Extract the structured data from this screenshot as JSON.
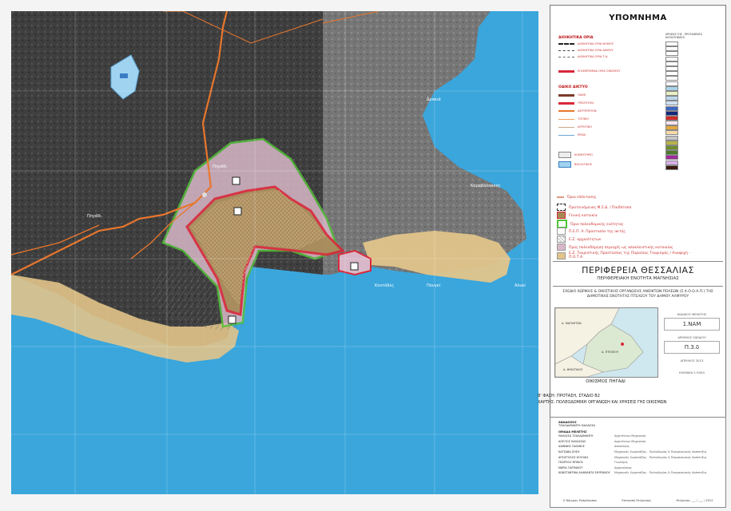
{
  "legend": {
    "title": "ΥΠΟΜΝΗΜΑ",
    "admin_header": "ΔΙΟΙΚΗΤΙΚΑ ΟΡΙΑ",
    "admin_items": [
      "ΔΙΟΙΚΗΤΙΚΑ ΟΡΙΑ ΝΟΜΟΥ",
      "ΔΙΟΙΚΗΤΙΚΑ ΟΡΙΑ ΔΗΜΟΥ",
      "ΔΙΟΙΚΗΤΙΚΑ ΟΡΙΑ Τ.Δ.",
      "ΕΓΚΕΚΡΙΜΕΝΑ ΟΡΙΑ ΟΙΚΙΣΜΟΥ"
    ],
    "roads_header": "ΟΔΙΚΟ ΔΙΚΤΥΟ",
    "road_items": [
      "ΠΑΘΕ",
      "ΠΡΩΤΕΥΟΝ",
      "ΔΕΥΤΕΡΕΥΟΝ",
      "ΤΟΠΙΚΟ",
      "ΑΓΡΟΤΙΚΟ",
      "ΡΕΜΑ"
    ],
    "poi_items": [
      "ΚΟΙΜΗΤΗΡΙΟ",
      "ΒΙΟΛΟΓΙΚΟΣ"
    ],
    "right_header": "ΧΡΗΣΕΙΣ ΓΗΣ - ΠΡΟΤΑΘΕΝΤΑ ΚΑΤΑΣΤΗΜΑΤΑ",
    "bottom_items": [
      "Όριο επέκτασης",
      "Προτεινόμενος Μ.Σ.Δ. / Παιδότοπο",
      "Γενική κατοικία",
      "Όριο πολεοδομικής ενότητας",
      "Π.Ε.Π. Α. Προστασία της ακτής",
      "Ε.Ζ. αρχαιότητων",
      "Προς πολεοδόμηση περιοχές ως αποκλειστικής κατοικίας",
      "Ε.Ζ. Τουριστικής Προστασίας της Παραλίας Τουρισμός / Αναψυχή - Π.Ο.Τ.Α."
    ]
  },
  "map_labels": {
    "top_left_village": "Πηγάδι",
    "west_village": "Πηγάδι",
    "east_bay": "Δρακιά",
    "beach": "Κοντάδες",
    "point_a": "Πουγκί",
    "point_b": "Αλυκί",
    "rocky": "Καραβόλακκος"
  },
  "title": {
    "region": "ΠΕΡΙΦΕΡΕΙΑ ΘΕΣΣΑΛΙΑΣ",
    "unit": "ΠΕΡΙΦΕΡΕΙΑΚΗ ΕΝΟΤΗΤΑ ΜΑΓΝΗΣΙΑΣ",
    "study": "ΣΧΕΔΙΟ ΧΩΡΙΚΗΣ & ΟΙΚΙΣΤΙΚΗΣ ΟΡΓΑΝΩΣΗΣ ΑΝΟΙΚΤΩΝ ΠΟΛΕΩΝ (Σ.Χ.Ο.Ο.Α.Π.) ΤΗΣ ΔΗΜΟΤΙΚΗΣ ΕΝΟΤΗΤΑΣ ΠΤΕΛΕΟΥ ΤΟΥ ΔΗΜΟΥ ΑΛΜΥΡΟΥ"
  },
  "inset": {
    "caption": "ΟΙΚΙΣΜΟΣ ΠΗΓΑΔΙ",
    "labels": [
      "Δ. ΜΑΓΝΗΤΩΝ",
      "Δ. ΠΤΕΛΕΟΥ",
      "Δ. ΦΘΙΩΤΙΔΟΣ"
    ]
  },
  "info": {
    "code_label": "ΚΩΔΙΚΟΣ ΜΕΛΕΤΗΣ",
    "code_value": "1.ΝΑΜ",
    "drawing_label": "ΑΡΙΘΜΟΣ ΣΧΕΔΙΟΥ",
    "drawing_value": "Π.3.δ",
    "date": "ΑΠΡΙΛΙΟΣ 2013",
    "scale": "ΚΛΙΜΑΚΑ 1:5000"
  },
  "phase": {
    "line1": "Β' ΦΑΣΗ: ΠΡΟΤΑΣΗ, ΣΤΑΔΙΟ Β2",
    "line2": "ΧΑΡΤΗΣ: ΠΟΛΕΟΔΟΜΙΚΗ ΟΡΓΑΝΩΣΗ ΚΑΙ ΧΡΗΣΕΙΣ ΓΗΣ ΟΙΚΙΣΜΩΝ"
  },
  "team": {
    "header1": "ΑΝΑΔΟΧΟΣ",
    "contractor": "ΤΖΑΛΔΑΜΑΝΤΗ ΘΑΛΑΣΣΑ",
    "header2": "ΟΜΑΔΑ ΜΕΛΕΤΗΣ",
    "members": [
      {
        "name": "ΘΑΛΑΣΣΑ ΤΖΑΛΔΑΜΑΝΤΗ",
        "role": "Αρχιτέκτων Μηχανικός"
      },
      {
        "name": "ΑΛΕΞΙΟΣ ΘΑΛΑΣΣΑΣ",
        "role": "Αρχιτέκτων Μηχανικός"
      },
      {
        "name": "ΙΩΑΝΝΗΣ ΓΑΛΑΝΟΣ",
        "role": "Δασολόγος"
      },
      {
        "name": "ΚΑΤΣΑΒΑ ΖΗΣΗ",
        "role": "Μηχανικός Χωροταξίας - Πολεοδομίας & Περιφερειακής Ανάπτυξης"
      },
      {
        "name": "ΑΠΟΣΤΟΛΟΣ ΚΟΥΛΙΑΣ",
        "role": "Μηχανικός Χωροταξίας - Πολεοδομίας & Περιφερειακής Ανάπτυξης"
      },
      {
        "name": "ΓΕΩΡΓΙΟΣ ΜΠΙΚΟΣ",
        "role": "Γεωλόγος"
      },
      {
        "name": "ΜΑΡΙΑ ΓΙΑΤΡΑΚΟΥ",
        "role": "Αρχαιολόγος"
      },
      {
        "name": "ΚΩΝΣΤΑΝΤΙΝΑ ΑΛΑΜΑΝΤΑ ΣΚΥΡΙΑΝΟΥ",
        "role": "Μηχανικός Χωροταξίας - Πολεοδομίας & Περιφερειακής Ανάπτυξης"
      }
    ],
    "sig1": "Ο Νόμιμος Εκπρόσωπος",
    "sig2": "Επιτροπή Θεώρησης",
    "sig3": "Θεώρηση: ___ / ___ / 2012"
  },
  "colors": {
    "sea": "#3aa6dc",
    "land_dark": "#3a3a3a",
    "beach": "#e2c48a",
    "residential": "#d8b8c8",
    "boundary_red": "#d9283a",
    "boundary_green": "#54c23a",
    "road_orange": "#e8762c"
  }
}
